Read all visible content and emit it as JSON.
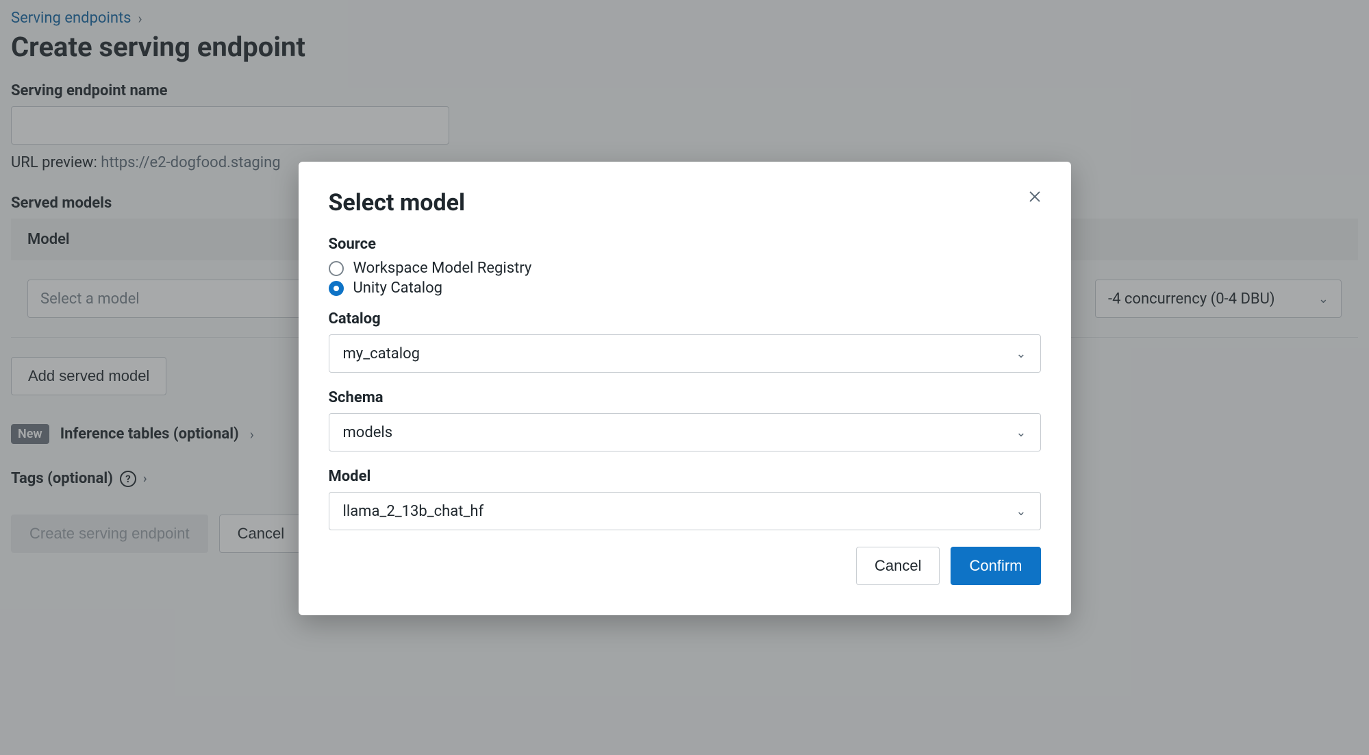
{
  "breadcrumb": {
    "link": "Serving endpoints"
  },
  "page_title": "Create serving endpoint",
  "endpoint_name": {
    "label": "Serving endpoint name",
    "value": ""
  },
  "url_preview": {
    "label": "URL preview: ",
    "value": "https://e2-dogfood.staging"
  },
  "served_models": {
    "label": "Served models",
    "column": "Model",
    "select_model_placeholder": "Select a model",
    "concurrency_value": "-4 concurrency (0-4 DBU)"
  },
  "buttons": {
    "add_served_model": "Add served model",
    "create_endpoint": "Create serving endpoint",
    "cancel": "Cancel"
  },
  "inference_tables": {
    "badge": "New",
    "label": "Inference tables (optional)"
  },
  "tags": {
    "label": "Tags (optional)"
  },
  "modal": {
    "title": "Select model",
    "source_label": "Source",
    "radio_workspace": "Workspace Model Registry",
    "radio_unity": "Unity Catalog",
    "catalog_label": "Catalog",
    "catalog_value": "my_catalog",
    "schema_label": "Schema",
    "schema_value": "models",
    "model_label": "Model",
    "model_value": "llama_2_13b_chat_hf",
    "cancel": "Cancel",
    "confirm": "Confirm"
  }
}
